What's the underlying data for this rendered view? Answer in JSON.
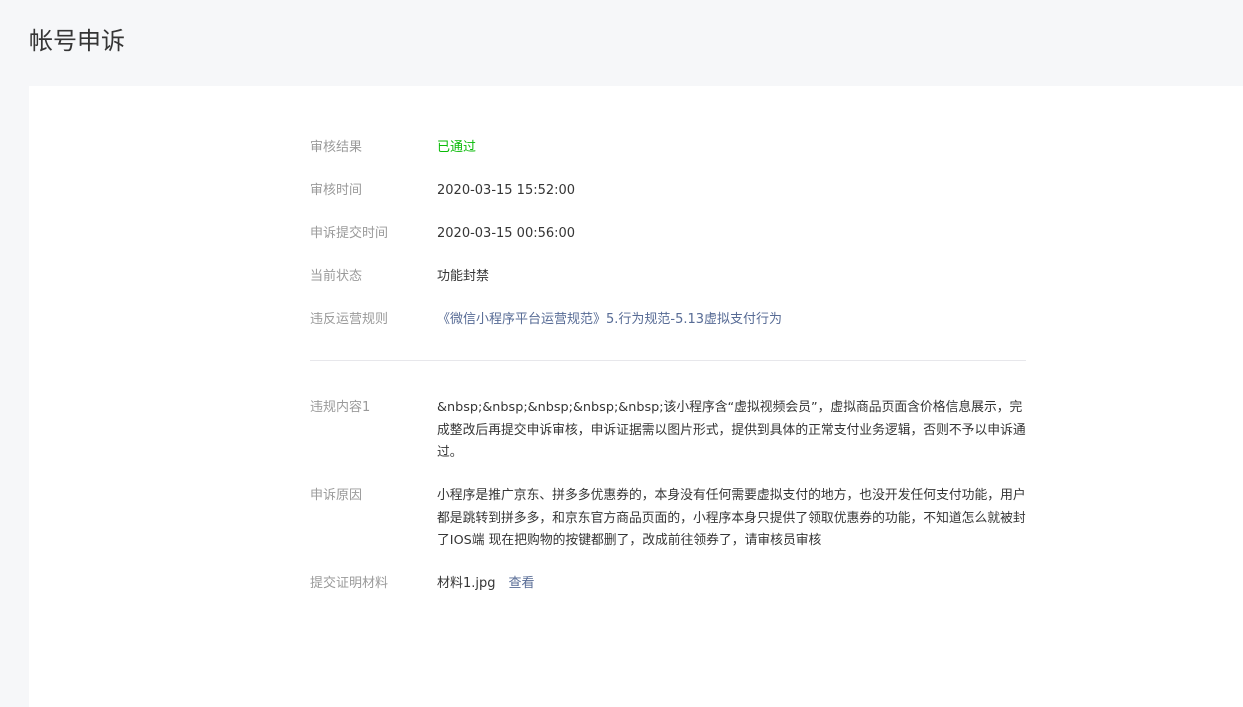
{
  "header": {
    "title": "帐号申诉"
  },
  "details": {
    "review_result": {
      "label": "审核结果",
      "value": "已通过"
    },
    "review_time": {
      "label": "审核时间",
      "value": "2020-03-15 15:52:00"
    },
    "submit_time": {
      "label": "申诉提交时间",
      "value": "2020-03-15 00:56:00"
    },
    "current_status": {
      "label": "当前状态",
      "value": "功能封禁"
    },
    "violated_rule": {
      "label": "违反运营规则",
      "value": "《微信小程序平台运营规范》5.行为规范-5.13虚拟支付行为"
    },
    "violation_content": {
      "label": "违规内容1",
      "value": "&nbsp;&nbsp;&nbsp;&nbsp;&nbsp;该小程序含“虚拟视频会员”，虚拟商品页面含价格信息展示，完成整改后再提交申诉审核，申诉证据需以图片形式，提供到具体的正常支付业务逻辑，否则不予以申诉通过。"
    },
    "appeal_reason": {
      "label": "申诉原因",
      "value": "小程序是推广京东、拼多多优惠券的，本身没有任何需要虚拟支付的地方，也没开发任何支付功能，用户都是跳转到拼多多，和京东官方商品页面的，小程序本身只提供了领取优惠券的功能，不知道怎么就被封了IOS端 现在把购物的按键都删了，改成前往领券了，请审核员审核"
    },
    "evidence": {
      "label": "提交证明材料",
      "file_name": "材料1.jpg",
      "view_label": "查看"
    }
  },
  "colors": {
    "success": "#09bb07",
    "link": "#576b95",
    "label": "#9a9a9a",
    "text": "#353535",
    "background": "#f6f7f9"
  }
}
